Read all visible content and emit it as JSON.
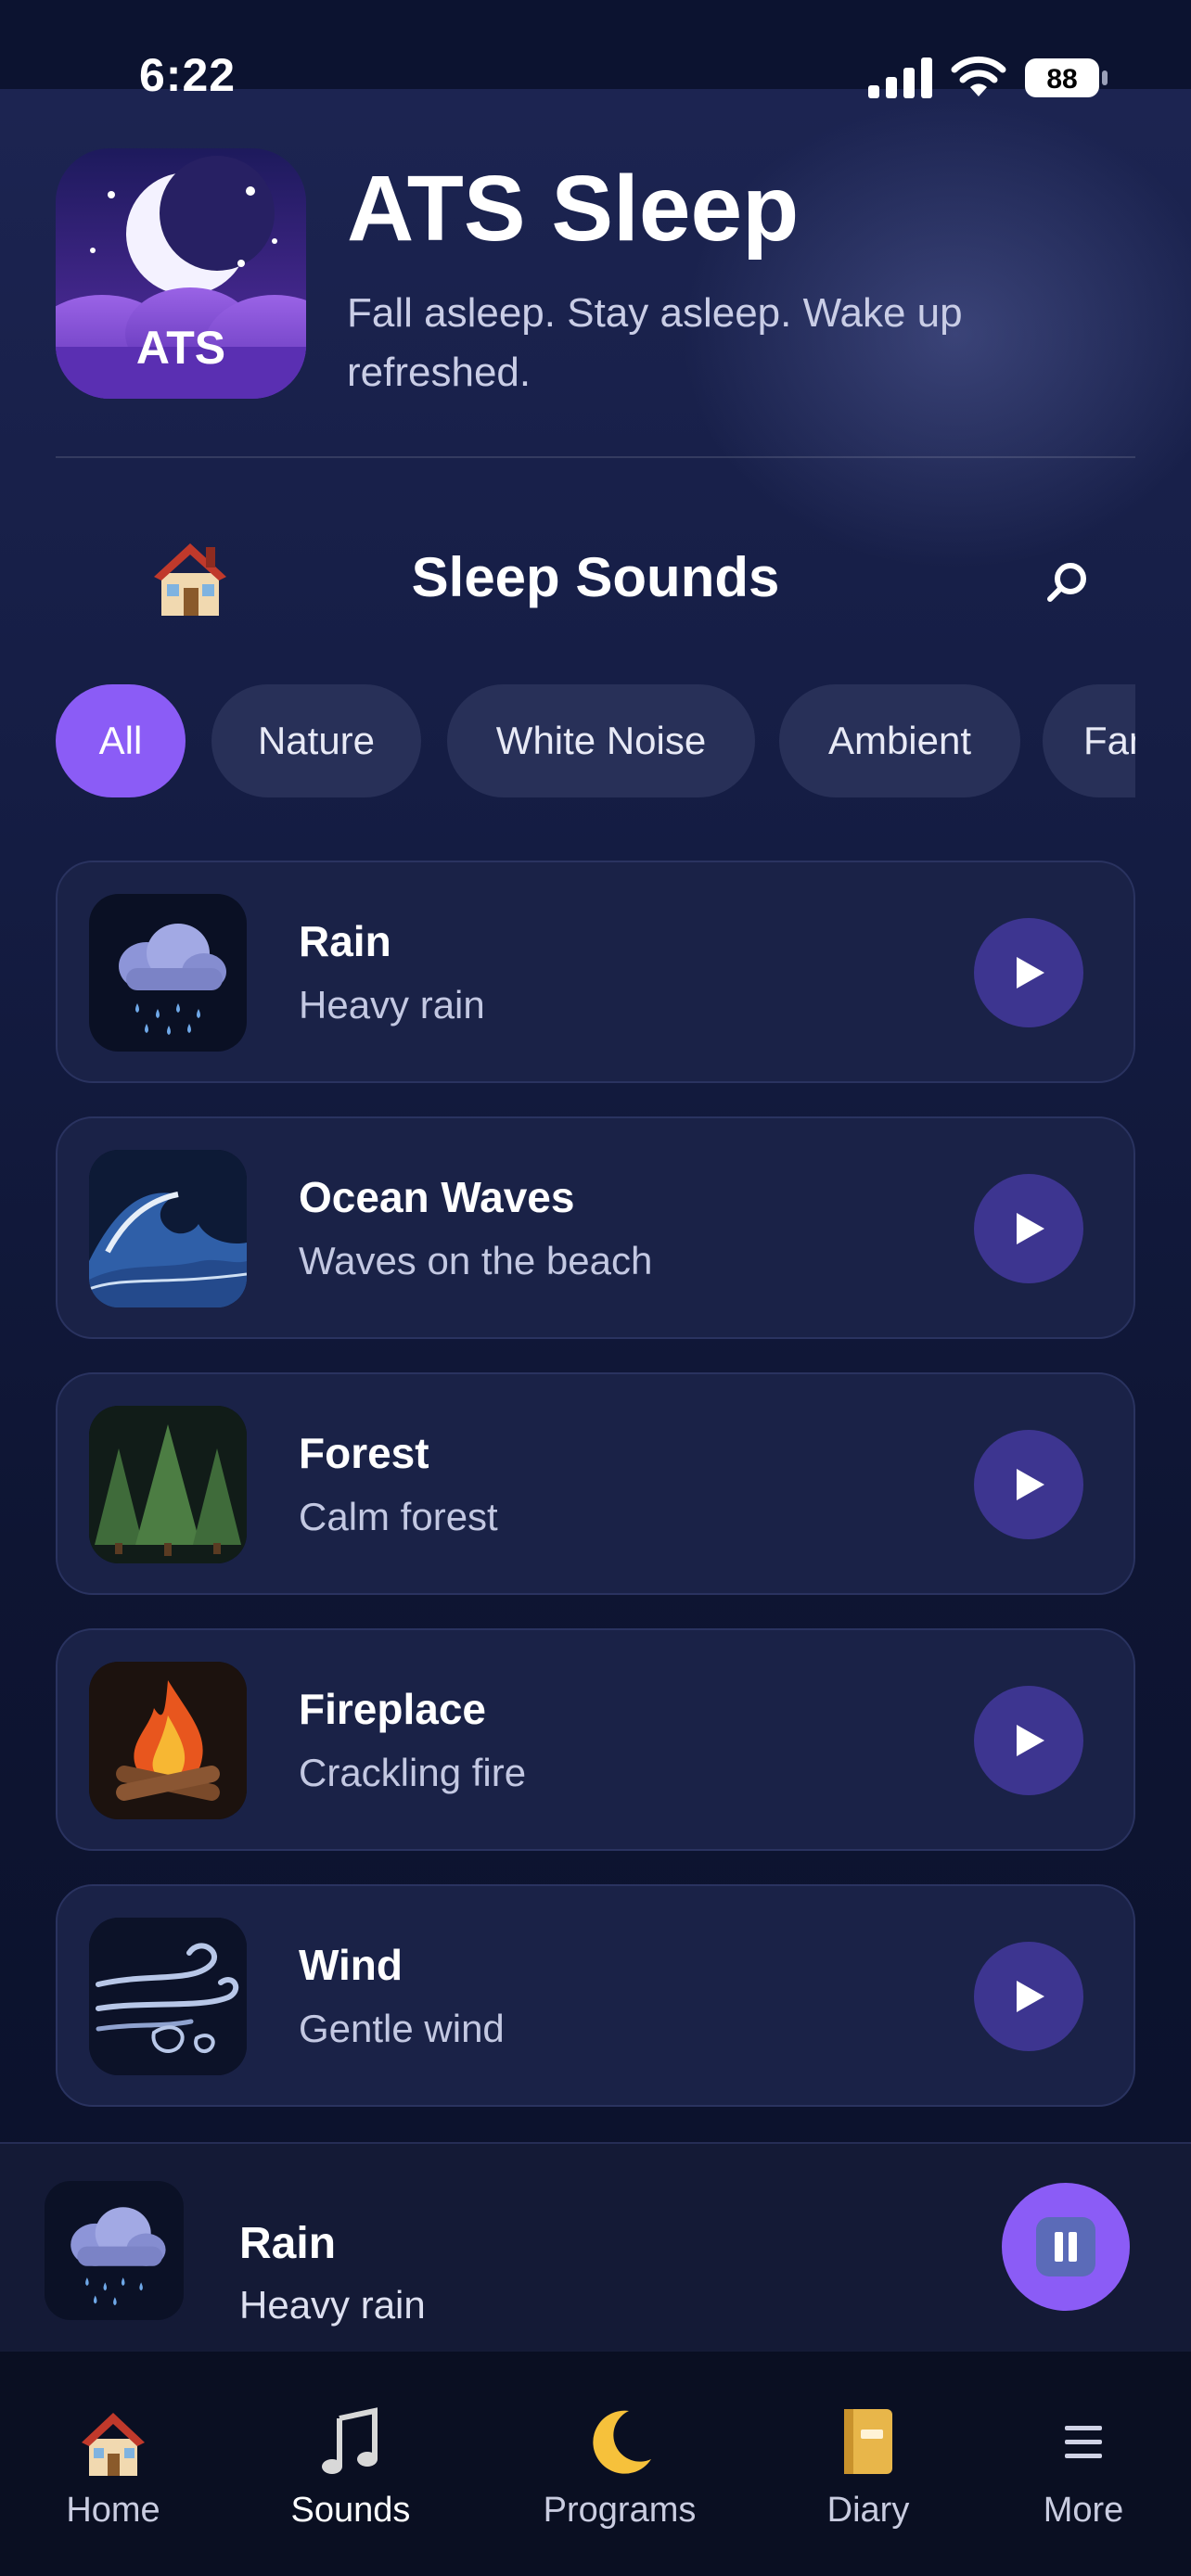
{
  "status_bar": {
    "time": "6:22",
    "battery": "88"
  },
  "header": {
    "icon_text": "ATS",
    "title": "ATS Sleep",
    "tagline": "Fall asleep. Stay asleep. Wake up refreshed."
  },
  "section": {
    "title": "Sleep Sounds"
  },
  "filters": [
    {
      "label": "All",
      "active": true
    },
    {
      "label": "Nature",
      "active": false
    },
    {
      "label": "White Noise",
      "active": false
    },
    {
      "label": "Ambient",
      "active": false
    },
    {
      "label": "Fan",
      "active": false
    }
  ],
  "sounds": [
    {
      "title": "Rain",
      "subtitle": "Heavy rain",
      "icon": "rain-cloud-icon"
    },
    {
      "title": "Ocean Waves",
      "subtitle": "Waves on the beach",
      "icon": "wave-icon"
    },
    {
      "title": "Forest",
      "subtitle": "Calm forest",
      "icon": "pine-trees-icon"
    },
    {
      "title": "Fireplace",
      "subtitle": "Crackling fire",
      "icon": "campfire-icon"
    },
    {
      "title": "Wind",
      "subtitle": "Gentle wind",
      "icon": "wind-icon"
    }
  ],
  "now_playing": {
    "title": "Rain",
    "subtitle": "Heavy rain",
    "state": "playing"
  },
  "tabs": [
    {
      "label": "Home",
      "icon": "house-icon",
      "active": false
    },
    {
      "label": "Sounds",
      "icon": "music-notes-icon",
      "active": true
    },
    {
      "label": "Programs",
      "icon": "moon-icon",
      "active": false
    },
    {
      "label": "Diary",
      "icon": "notebook-icon",
      "active": false
    },
    {
      "label": "More",
      "icon": "menu-icon",
      "active": false
    }
  ],
  "colors": {
    "accent": "#8b5cf6",
    "play_button": "#3d3590",
    "card": "#1a2247",
    "chip": "#283058"
  }
}
